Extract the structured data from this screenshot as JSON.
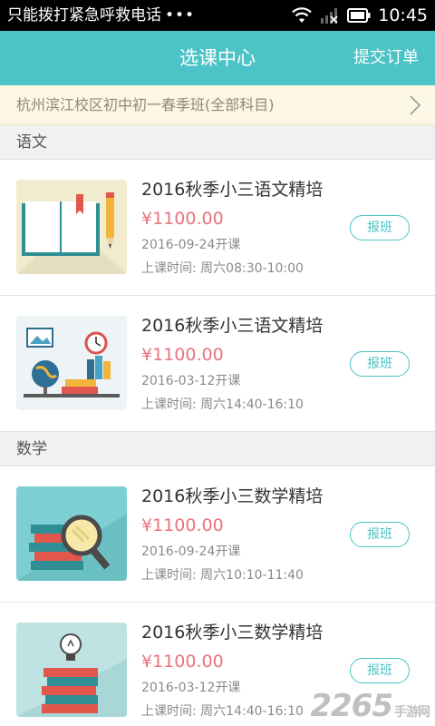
{
  "status_bar": {
    "carrier": "只能拨打紧急呼救电话",
    "dots": "•••",
    "time": "10:45"
  },
  "header": {
    "title": "选课中心",
    "submit_order": "提交订单"
  },
  "class_selector": {
    "text": "杭州滨江校区初中初一春季班(全部科目)"
  },
  "sections": [
    {
      "title": "语文",
      "courses": [
        {
          "name": "2016秋季小三语文精培",
          "price": "¥1100.00",
          "start": "2016-09-24开课",
          "schedule_label": "上课时间:",
          "schedule": "周六08:30-10:00",
          "button": "报班",
          "thumb": "book-pencil-illustration"
        },
        {
          "name": "2016秋季小三语文精培",
          "price": "¥1100.00",
          "start": "2016-03-12开课",
          "schedule_label": "上课时间:",
          "schedule": "周六14:40-16:10",
          "button": "报班",
          "thumb": "globe-clock-books-illustration"
        }
      ]
    },
    {
      "title": "数学",
      "courses": [
        {
          "name": "2016秋季小三数学精培",
          "price": "¥1100.00",
          "start": "2016-09-24开课",
          "schedule_label": "上课时间:",
          "schedule": "周六10:10-11:40",
          "button": "报班",
          "thumb": "books-magnifier-illustration"
        },
        {
          "name": "2016秋季小三数学精培",
          "price": "¥1100.00",
          "start": "2016-03-12开课",
          "schedule_label": "上课时间:",
          "schedule": "周六14:40-16:10",
          "button": "报班",
          "thumb": "books-lightbulb-illustration"
        }
      ]
    }
  ],
  "watermark": {
    "number": "2265",
    "suffix": "手游网"
  },
  "colors": {
    "accent": "#4cc3c6",
    "price": "#e9737c",
    "selector_bg": "#fbf7e4"
  }
}
